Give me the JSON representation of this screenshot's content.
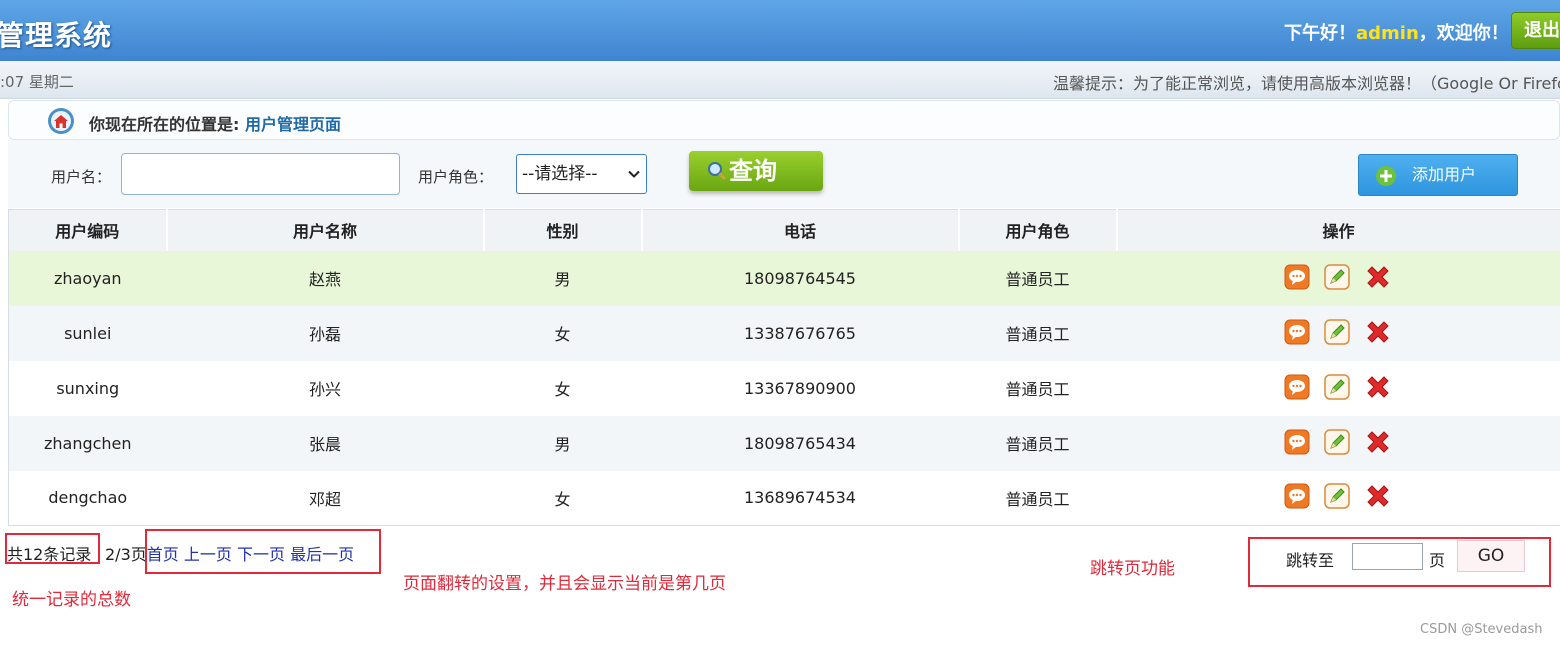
{
  "header": {
    "title": "管理系统",
    "greeting_prefix": "下午好！",
    "username": "admin",
    "greeting_suffix": "，欢迎你！",
    "logout_label": "退出"
  },
  "subheader": {
    "date_text": ":07  星期二",
    "tip_text": "温馨提示：为了能正常浏览，请使用高版本浏览器！（Google Or Firefox"
  },
  "breadcrumb": {
    "prefix": "你现在所在的位置是:",
    "page": "用户管理页面"
  },
  "search": {
    "username_label": "用户名：",
    "username_value": "",
    "role_label": "用户角色：",
    "role_selected": "--请选择--",
    "query_label": "查询",
    "add_label": "添加用户"
  },
  "table": {
    "columns": [
      "用户编码",
      "用户名称",
      "性别",
      "电话",
      "用户角色",
      "操作"
    ],
    "rows": [
      [
        "zhaoyan",
        "赵燕",
        "男",
        "18098764545",
        "普通员工"
      ],
      [
        "sunlei",
        "孙磊",
        "女",
        "13387676765",
        "普通员工"
      ],
      [
        "sunxing",
        "孙兴",
        "女",
        "13367890900",
        "普通员工"
      ],
      [
        "zhangchen",
        "张晨",
        "男",
        "18098765434",
        "普通员工"
      ],
      [
        "dengchao",
        "邓超",
        "女",
        "13689674534",
        "普通员工"
      ]
    ]
  },
  "pagination": {
    "total_records": "共12条记录",
    "page_info": "2/3页",
    "first": "首页",
    "prev": "上一页",
    "next": "下一页",
    "last": "最后一页",
    "jump_label": "跳转至",
    "jump_value": "",
    "page_unit": "页",
    "go_label": "GO"
  },
  "annotations": {
    "total_note": "统一记录的总数",
    "paging_note": "页面翻转的设置，并且会显示当前是第几页",
    "jump_note": "跳转页功能"
  },
  "watermark": "CSDN @Stevedash",
  "colors": {
    "header_blue": "#4a8fd8",
    "accent_green": "#7ab51d",
    "add_blue": "#3a9fe6",
    "highlight_row": "#e9f7d9",
    "annotation_red": "#e0293a",
    "username_yellow": "#ffe21a"
  },
  "icons": {
    "row_actions": [
      "view-icon",
      "edit-icon",
      "delete-icon"
    ],
    "breadcrumb": "home-icon",
    "query": "magnifier-icon",
    "add": "plus-icon"
  }
}
